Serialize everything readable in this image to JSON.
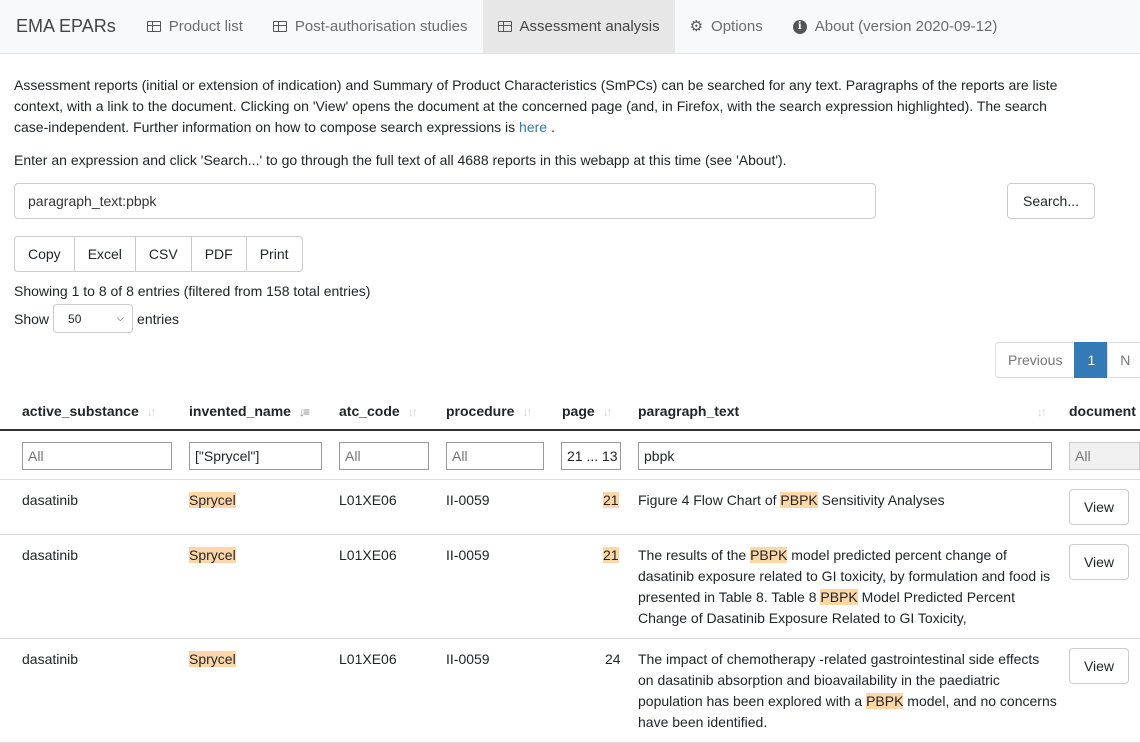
{
  "nav": {
    "brand": "EMA EPARs",
    "items": [
      {
        "label": "Product list",
        "icon": "table-icon"
      },
      {
        "label": "Post-authorisation studies",
        "icon": "table-icon"
      },
      {
        "label": "Assessment analysis",
        "icon": "table-icon",
        "active": true
      },
      {
        "label": "Options",
        "icon": "gear-icon"
      },
      {
        "label": "About (version 2020-09-12)",
        "icon": "info-icon"
      }
    ]
  },
  "intro": {
    "line1": "Assessment reports (initial or extension of indication) and Summary of Product Characteristics (SmPCs) can be searched for any text. Paragraphs of the reports are liste",
    "line2": "context, with a link to the document. Clicking on 'View' opens the document at the concerned page (and, in Firefox, with the search expression highlighted). The search",
    "line3_pre": "case-independent. Further information on how to compose search expressions is ",
    "link": "here",
    "line3_post": " ."
  },
  "prompt": "Enter an expression and click 'Search...' to go through the full text of all 4688 reports in this webapp at this time (see 'About').",
  "search": {
    "value": "paragraph_text:pbpk",
    "button": "Search..."
  },
  "export_buttons": [
    "Copy",
    "Excel",
    "CSV",
    "PDF",
    "Print"
  ],
  "info": "Showing 1 to 8 of 8 entries (filtered from 158 total entries)",
  "length": {
    "pre": "Show",
    "value": "50",
    "post": "entries"
  },
  "pagination": {
    "previous": "Previous",
    "current": "1",
    "next": "N"
  },
  "table": {
    "columns": [
      "active_substance",
      "invented_name",
      "atc_code",
      "procedure",
      "page",
      "paragraph_text",
      "document"
    ],
    "filters": {
      "active_substance": "All",
      "invented_name": "[\"Sprycel\"]",
      "atc_code": "All",
      "procedure": "All",
      "page": "21 ... 13",
      "paragraph_text": "pbpk",
      "document": "All"
    },
    "view_label": "View",
    "rows": [
      {
        "active_substance": "dasatinib",
        "invented_name": "Sprycel",
        "atc_code": "L01XE06",
        "procedure": "II-0059",
        "page": "21",
        "page_hl": true,
        "para": [
          {
            "t": "Figure 4 Flow Chart of "
          },
          {
            "t": "PBPK",
            "h": true
          },
          {
            "t": " Sensitivity Analyses"
          }
        ]
      },
      {
        "active_substance": "dasatinib",
        "invented_name": "Sprycel",
        "atc_code": "L01XE06",
        "procedure": "II-0059",
        "page": "21",
        "page_hl": true,
        "para": [
          {
            "t": "The results of the "
          },
          {
            "t": "PBPK",
            "h": true
          },
          {
            "t": " model predicted percent change of dasatinib exposure related to GI toxicity, by formulation and food is presented in Table 8. Table 8 "
          },
          {
            "t": "PBPK",
            "h": true
          },
          {
            "t": " Model Predicted Percent Change of Dasatinib Exposure Related to GI Toxicity,"
          }
        ]
      },
      {
        "active_substance": "dasatinib",
        "invented_name": "Sprycel",
        "atc_code": "L01XE06",
        "procedure": "II-0059",
        "page": "24",
        "page_hl": false,
        "para": [
          {
            "t": "The impact of chemotherapy -related gastrointestinal side effects on dasatinib absorption and bioavailability in the paediatric population has been explored with a "
          },
          {
            "t": "PBPK",
            "h": true
          },
          {
            "t": " model, and no concerns have been identified."
          }
        ]
      }
    ]
  }
}
